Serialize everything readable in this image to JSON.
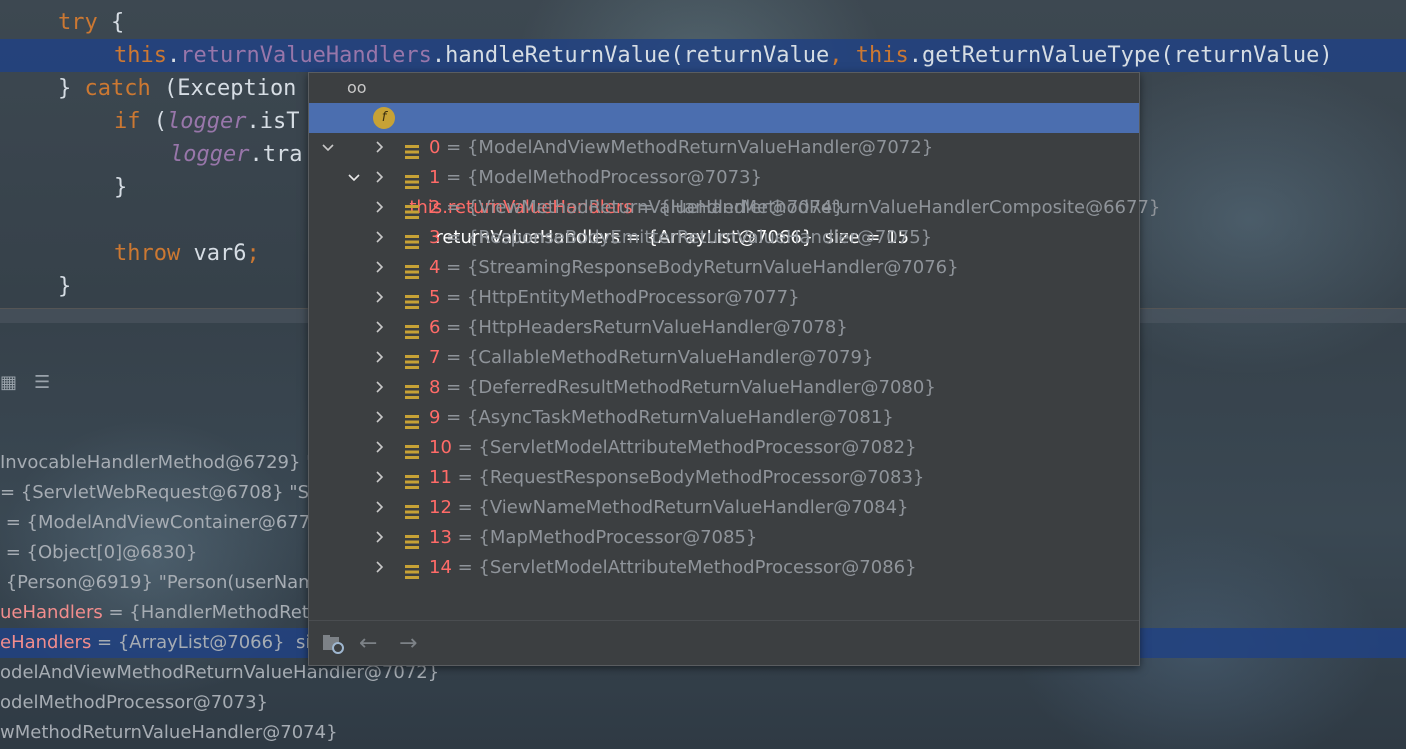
{
  "editor": {
    "lines": [
      {
        "parts": [
          [
            "kw",
            "try"
          ],
          [
            "pl",
            " {"
          ]
        ]
      },
      {
        "parts": [
          [
            "kw",
            "this"
          ],
          [
            "pl",
            "."
          ],
          [
            "fld",
            "returnValueHandlers"
          ],
          [
            "pl",
            ".handleReturnValue(returnValue"
          ],
          [
            "kw",
            ", this"
          ],
          [
            "pl",
            ".getReturnValueType(returnValue)"
          ]
        ]
      },
      {
        "parts": [
          [
            "pl",
            "} "
          ],
          [
            "kw",
            "catch"
          ],
          [
            "pl",
            " (Exception"
          ]
        ]
      },
      {
        "parts": [
          [
            "kw",
            "if"
          ],
          [
            "pl",
            " ("
          ],
          [
            "itl",
            "logger"
          ],
          [
            "pl",
            ".isT"
          ]
        ]
      },
      {
        "parts": [
          [
            "itl",
            "logger"
          ],
          [
            "pl",
            ".tra"
          ]
        ]
      },
      {
        "parts": [
          [
            "pl",
            "}"
          ]
        ]
      },
      {
        "parts": [
          [
            "kw",
            "throw"
          ],
          [
            "pl",
            " var6"
          ],
          [
            "kw",
            ";"
          ]
        ]
      },
      {
        "parts": [
          [
            "pl",
            "}"
          ]
        ]
      }
    ]
  },
  "variables": [
    {
      "name": "",
      "value": "InvocableHandlerMethod@6729} \"c"
    },
    {
      "name": "",
      "value": "= {ServletWebRequest@6708} \"Servle"
    },
    {
      "name": "",
      "value": " = {ModelAndViewContainer@6774"
    },
    {
      "name": "",
      "value": " = {Object[0]@6830}"
    },
    {
      "name": "",
      "value": " {Person@6919} \"Person(userName="
    },
    {
      "name": "ueHandlers",
      "value": " = {HandlerMethodReturn"
    },
    {
      "name": "eHandlers",
      "value": " = {ArrayList@7066}  size"
    },
    {
      "name": "",
      "value": "odelAndViewMethodReturnValueHandler@7072}"
    },
    {
      "name": "",
      "value": "odelMethodProcessor@7073}"
    },
    {
      "name": "",
      "value": "wMethodReturnValueHandler@7074}"
    }
  ],
  "popup": {
    "root": {
      "name": "this.returnValueHandlers",
      "value": " = {HandlerMethodReturnValueHandlerComposite@6677}"
    },
    "field": {
      "name": "returnValueHandlers",
      "value": " = {ArrayList@7066}  size = 15"
    },
    "items": [
      {
        "idx": "0",
        "value": " = {ModelAndViewMethodReturnValueHandler@7072}"
      },
      {
        "idx": "1",
        "value": " = {ModelMethodProcessor@7073}"
      },
      {
        "idx": "2",
        "value": " = {ViewMethodReturnValueHandler@7074}"
      },
      {
        "idx": "3",
        "value": " = {ResponseBodyEmitterReturnValueHandler@7075}"
      },
      {
        "idx": "4",
        "value": " = {StreamingResponseBodyReturnValueHandler@7076}"
      },
      {
        "idx": "5",
        "value": " = {HttpEntityMethodProcessor@7077}"
      },
      {
        "idx": "6",
        "value": " = {HttpHeadersReturnValueHandler@7078}"
      },
      {
        "idx": "7",
        "value": " = {CallableMethodReturnValueHandler@7079}"
      },
      {
        "idx": "8",
        "value": " = {DeferredResultMethodReturnValueHandler@7080}"
      },
      {
        "idx": "9",
        "value": " = {AsyncTaskMethodReturnValueHandler@7081}"
      },
      {
        "idx": "10",
        "value": " = {ServletModelAttributeMethodProcessor@7082}"
      },
      {
        "idx": "11",
        "value": " = {RequestResponseBodyMethodProcessor@7083}"
      },
      {
        "idx": "12",
        "value": " = {ViewNameMethodReturnValueHandler@7084}"
      },
      {
        "idx": "13",
        "value": " = {MapMethodProcessor@7085}"
      },
      {
        "idx": "14",
        "value": " = {ServletModelAttributeMethodProcessor@7086}"
      }
    ]
  },
  "colors": {
    "selection": "#4b6eaf",
    "keyword": "#cc7832",
    "field": "#9876aa",
    "index": "#ff6b68"
  }
}
